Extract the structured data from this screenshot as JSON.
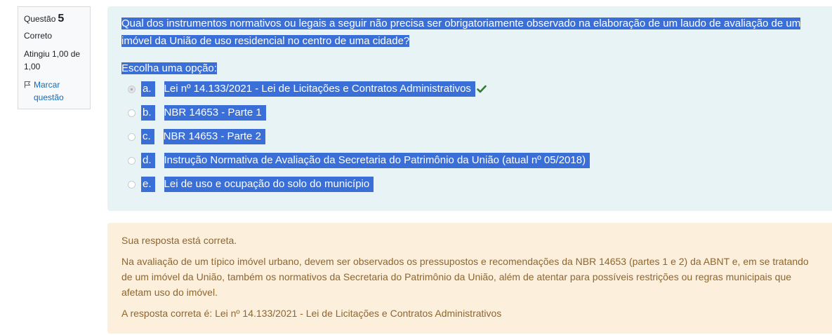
{
  "info": {
    "question_label": "Questão",
    "question_number": "5",
    "state": "Correto",
    "grade": "Atingiu 1,00 de 1,00",
    "flag_label": "Marcar questão"
  },
  "question": {
    "text": "Qual dos instrumentos normativos ou legais a seguir não precisa ser obrigatoriamente observado na elaboração de um laudo de avaliação de um imóvel da União de uso residencial no centro de uma cidade?",
    "prompt": "Escolha uma opção:",
    "options": [
      {
        "letter": "a.",
        "text": "Lei nº 14.133/2021 - Lei de Licitações e Contratos Administrativos",
        "selected": true,
        "correct": true
      },
      {
        "letter": "b.",
        "text": "NBR 14653 - Parte 1",
        "selected": false
      },
      {
        "letter": "c.",
        "text": "NBR 14653 - Parte 2",
        "selected": false
      },
      {
        "letter": "d.",
        "text": "Instrução Normativa de Avaliação da Secretaria do Patrimônio da União (atual nº 05/2018)",
        "selected": false
      },
      {
        "letter": "e.",
        "text": "Lei de uso e ocupação do solo do município",
        "selected": false
      }
    ]
  },
  "feedback": {
    "status": "Sua resposta está correta.",
    "general": "Na avaliação de um típico imóvel urbano, devem ser observados os pressupostos e recomendações da NBR 14653 (partes 1 e 2) da ABNT e, em se tratando de um imóvel da União, também os normativos da Secretaria do Patrimônio da União, além de atentar para possíveis restrições ou regras municipais que afetam uso do imóvel.",
    "right_answer": "A resposta correta é: Lei nº 14.133/2021 - Lei de Licitações e Contratos Administrativos"
  },
  "colors": {
    "selection": "#3a6fd8",
    "correct_check": "#357a32",
    "link": "#0f6cbf",
    "formulation_bg": "#e7f3f5",
    "outcome_bg": "#fcefdc",
    "outcome_text": "#8e662e"
  },
  "icons": {
    "flag": "flag-icon",
    "correct": "check-icon"
  }
}
